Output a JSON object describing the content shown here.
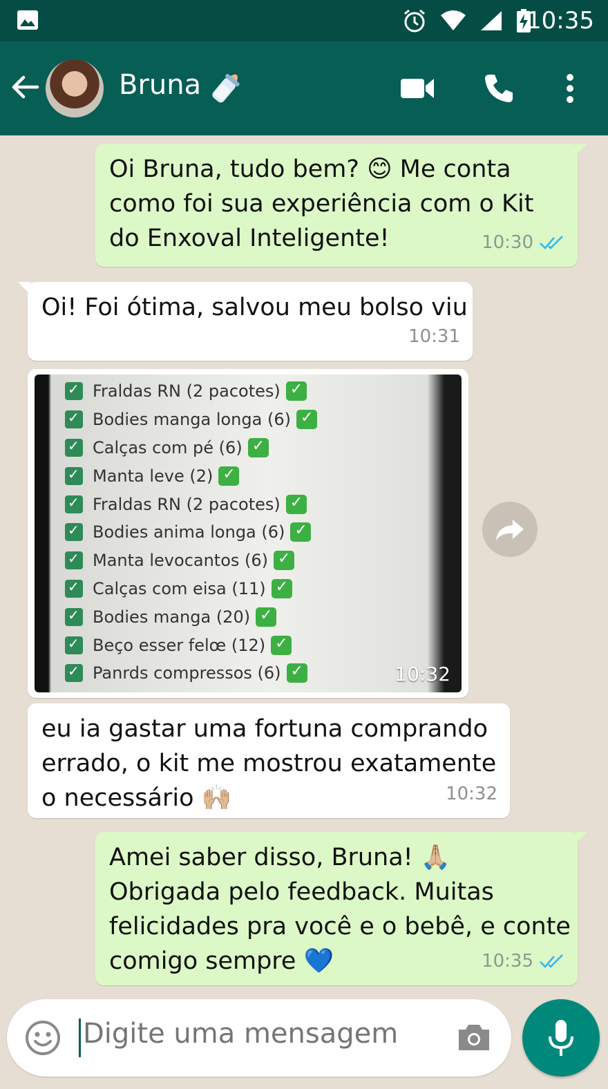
{
  "status_bar": {
    "time": "10:35"
  },
  "header": {
    "contact_name": "Bruna",
    "contact_emoji": "baby-bottle-icon"
  },
  "messages": [
    {
      "dir": "out",
      "text": "Oi Bruna, tudo bem? 😊 Me conta\ncomo foi sua experiência com o Kit\ndo Enxoval Inteligente!",
      "time": "10:30",
      "read": true
    },
    {
      "dir": "in",
      "text": "Oi! Foi ótima, salvou meu bolso viu",
      "time": "10:31"
    },
    {
      "dir": "in",
      "type": "image",
      "time": "10:32",
      "checklist": [
        "Fraldas RN (2 pacotes)",
        "Bodies manga longa (6)",
        "Calças com pé (6)",
        "Manta leve (2)",
        "Fraldas RN (2 pacotes)",
        "Bodies anima longa (6)",
        "Manta levocantos (6)",
        "Calças com eisa (11)",
        "Bodies manga (20)",
        "Beço esser felœ (12)",
        "Panrds compressos (6)"
      ]
    },
    {
      "dir": "in",
      "text": "eu ia gastar uma fortuna comprando\nerrado, o kit me mostrou exatamente\no necessário 🙌🏼",
      "time": "10:32"
    },
    {
      "dir": "out",
      "text": "Amei saber disso, Bruna! 🙏🏼\nObrigada pelo feedback. Muitas\nfelicidades pra você e o bebê, e conte\ncomigo sempre 💙",
      "time": "10:35",
      "read": true
    }
  ],
  "composer": {
    "placeholder": "Digite uma mensagem"
  },
  "colors": {
    "header": "#075e54",
    "status": "#054d44",
    "outgoing": "#dcf8c6",
    "incoming": "#ffffff",
    "accent": "#00897b",
    "read_tick": "#34b7f1"
  }
}
